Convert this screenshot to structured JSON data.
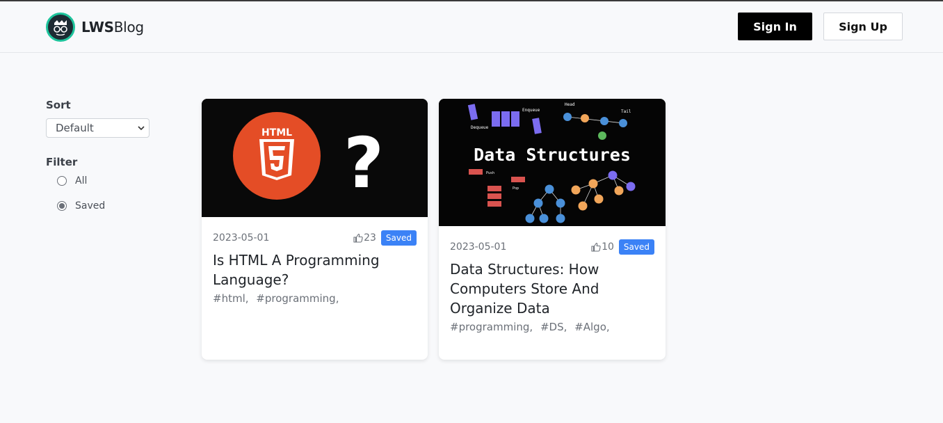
{
  "navbar": {
    "brand_bold": "LWS",
    "brand_regular": "Blog",
    "signin_label": "Sign In",
    "signup_label": "Sign Up"
  },
  "sidebar": {
    "sort_label": "Sort",
    "sort_selected": "Default",
    "filter_label": "Filter",
    "filter_options": [
      {
        "label": "All",
        "checked": false
      },
      {
        "label": "Saved",
        "checked": true
      }
    ]
  },
  "posts": [
    {
      "thumb_text": "HTML",
      "thumb_mark": "?",
      "date": "2023-05-01",
      "likes": "23",
      "badge": "Saved",
      "title": "Is HTML A Programming Language?",
      "tags": [
        "#html,",
        "#programming,"
      ]
    },
    {
      "thumb_title": "Data Structures",
      "thumb_labels": [
        "Enqueue",
        "Dequeue",
        "Head",
        "Tail",
        "Push",
        "Pop"
      ],
      "date": "2023-05-01",
      "likes": "10",
      "badge": "Saved",
      "title": "Data Structures: How Computers Store And Organize Data",
      "tags": [
        "#programming,",
        "#DS,",
        "#Algo,"
      ]
    }
  ],
  "colors": {
    "accent_blue": "#3b82f6",
    "html5_orange": "#e44d26",
    "logo_ring": "#1ec49c"
  }
}
